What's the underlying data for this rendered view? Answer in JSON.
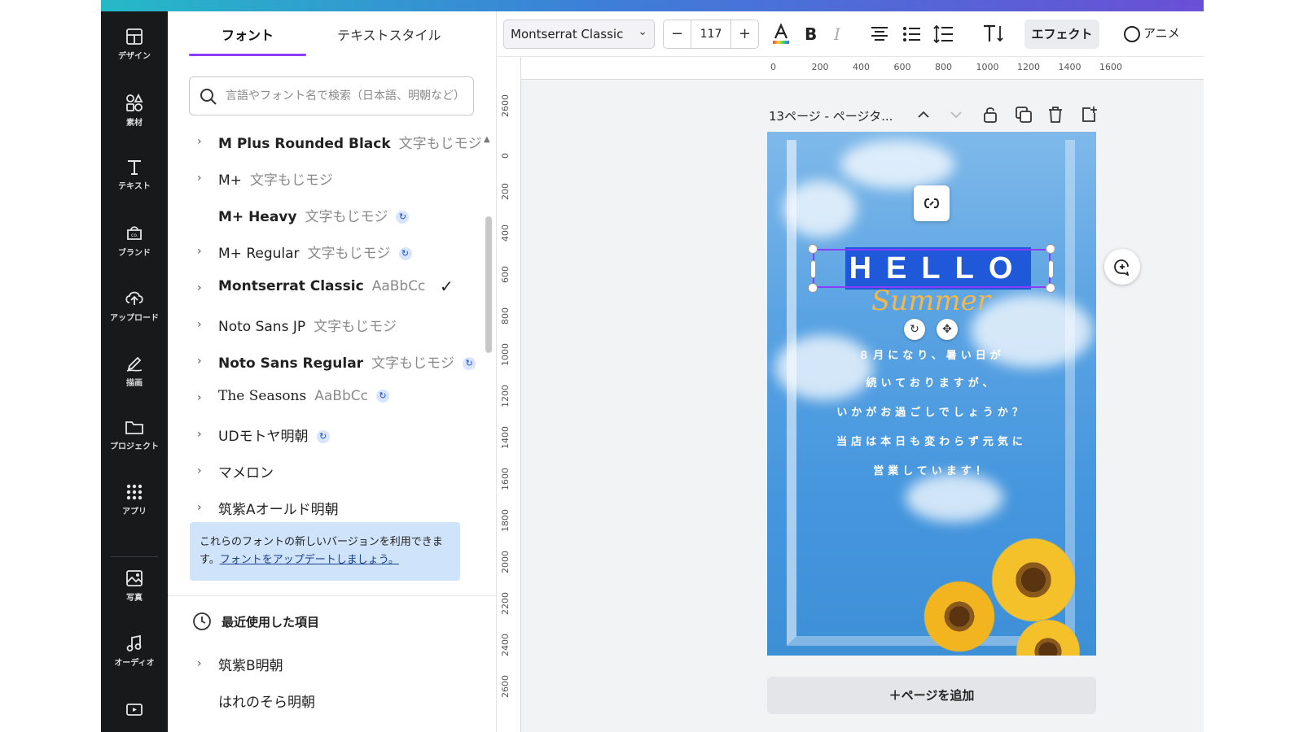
{
  "nav": {
    "items": [
      {
        "label": "デザイン",
        "icon": "layout-icon"
      },
      {
        "label": "素材",
        "icon": "shapes-icon"
      },
      {
        "label": "テキスト",
        "icon": "text-icon"
      },
      {
        "label": "ブランド",
        "icon": "brand-icon"
      },
      {
        "label": "アップロード",
        "icon": "upload-icon"
      },
      {
        "label": "描画",
        "icon": "draw-icon"
      },
      {
        "label": "プロジェクト",
        "icon": "folder-icon"
      },
      {
        "label": "アプリ",
        "icon": "apps-icon"
      },
      {
        "label": "写真",
        "icon": "photo-icon"
      },
      {
        "label": "オーディオ",
        "icon": "audio-icon"
      }
    ]
  },
  "panel": {
    "tabs": [
      "フォント",
      "テキストスタイル"
    ],
    "search_placeholder": "言語やフォント名で検索（日本語、明朝など）",
    "fonts": [
      {
        "name": "M Plus Rounded Black",
        "sample": "文字もじモジ",
        "chevron": true,
        "badge": false,
        "checked": false
      },
      {
        "name": "M+",
        "sample": "文字もじモジ",
        "chevron": true,
        "badge": false,
        "checked": false
      },
      {
        "name": "M+ Heavy",
        "sample": "文字もじモジ",
        "chevron": false,
        "badge": true,
        "checked": false
      },
      {
        "name": "M+ Regular",
        "sample": "文字もじモジ",
        "chevron": true,
        "badge": true,
        "checked": false
      },
      {
        "name": "Montserrat Classic",
        "sample": "AaBbCc",
        "chevron": true,
        "badge": false,
        "checked": true
      },
      {
        "name": "Noto Sans JP",
        "sample": "文字もじモジ",
        "chevron": true,
        "badge": false,
        "checked": false
      },
      {
        "name": "Noto Sans Regular",
        "sample": "文字もじモジ",
        "chevron": true,
        "badge": true,
        "checked": false
      },
      {
        "name": "The Seasons",
        "sample": "AaBbCc",
        "chevron": true,
        "badge": true,
        "checked": false
      },
      {
        "name": "UDモトヤ明朝",
        "sample": "",
        "chevron": true,
        "badge": true,
        "checked": false
      },
      {
        "name": "マメロン",
        "sample": "",
        "chevron": true,
        "badge": false,
        "checked": false
      },
      {
        "name": "筑紫Aオールド明朝",
        "sample": "",
        "chevron": true,
        "badge": false,
        "checked": false
      }
    ],
    "notice_text": "これらのフォントの新しいバージョンを利用できます。",
    "notice_link": "フォントをアップデートしましょう。",
    "recent_title": "最近使用した項目",
    "recent": [
      {
        "name": "筑紫B明朝",
        "chevron": true
      },
      {
        "name": "はれのそら明朝",
        "chevron": false
      }
    ]
  },
  "toolbar": {
    "font": "Montserrat Classic",
    "size": "117",
    "minus": "−",
    "plus": "+",
    "effect": "エフェクト",
    "animate": "アニメ"
  },
  "ruler": {
    "h": [
      "0",
      "200",
      "400",
      "600",
      "800",
      "1000",
      "1200",
      "1400",
      "1600"
    ],
    "v": [
      "2600",
      "0",
      "200",
      "400",
      "600",
      "800",
      "1000",
      "1200",
      "1400",
      "1600",
      "1800",
      "2000",
      "2200",
      "2400",
      "2600"
    ]
  },
  "page": {
    "title": "13ページ - ページタ...",
    "hello": "HELLO",
    "summer": "Summer",
    "body": [
      "８月になり、暑い日が",
      "続いておりますが、",
      "いかがお過ごしでしょうか？",
      "当店は本日も変わらず元気に",
      "営業しています！"
    ],
    "add_page": "＋ページを追加"
  }
}
